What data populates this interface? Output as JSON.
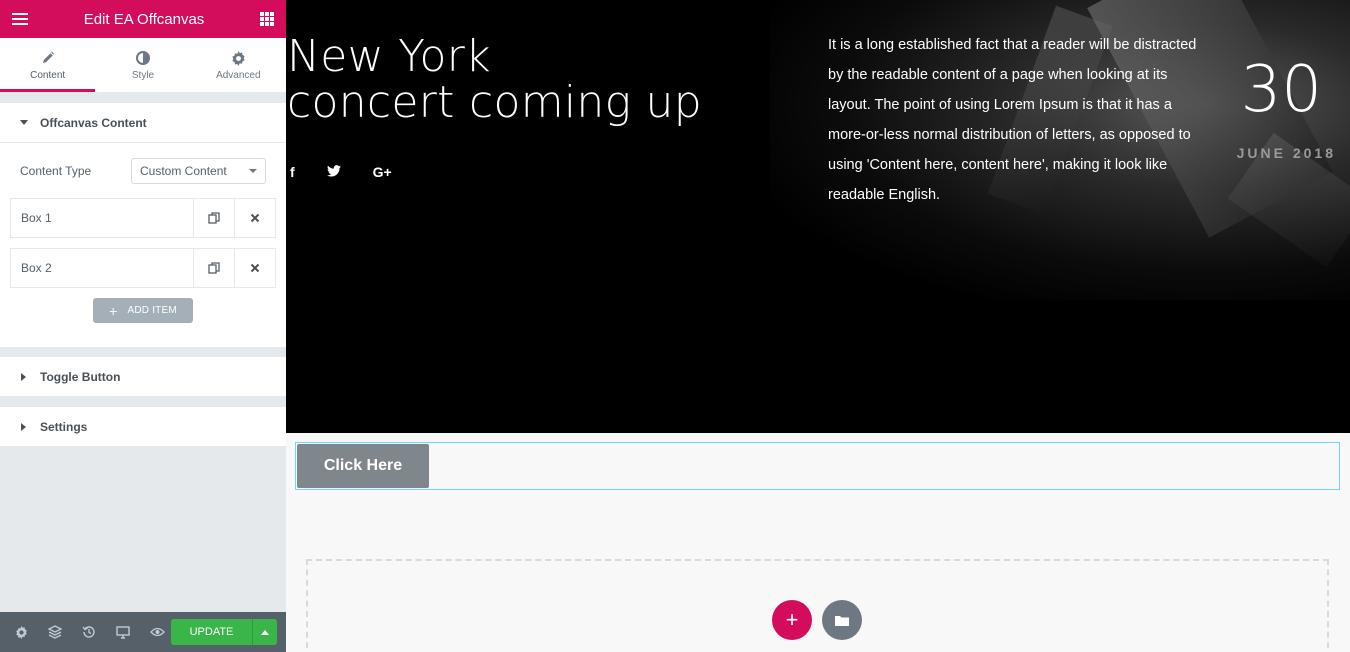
{
  "panel": {
    "title": "Edit EA Offcanvas",
    "tabs": [
      {
        "label": "Content",
        "icon": "pencil-icon"
      },
      {
        "label": "Style",
        "icon": "contrast-icon"
      },
      {
        "label": "Advanced",
        "icon": "gear-icon"
      }
    ],
    "sections": {
      "offcanvas_content": "Offcanvas Content",
      "toggle_button": "Toggle Button",
      "settings": "Settings"
    },
    "content_type": {
      "label": "Content Type",
      "value": "Custom Content"
    },
    "items": [
      {
        "title": "Box 1"
      },
      {
        "title": "Box 2"
      }
    ],
    "add_item_label": "ADD ITEM",
    "footer": {
      "update_label": "UPDATE"
    },
    "colors": {
      "accent": "#d30c5c",
      "update": "#39b54a",
      "footer": "#556068"
    }
  },
  "preview": {
    "hero": {
      "title_line1": "New York",
      "title_line2": "concert coming up",
      "social": [
        "f",
        "t",
        "G+"
      ],
      "text": "It is a long established fact that a reader will be distracted by the readable content of a page when looking at its layout. The point of using Lorem Ipsum is that it has a more-or-less normal distribution of letters, as opposed to using 'Content here, content here', making it look like readable English.",
      "day": "30",
      "month": "JUNE 2018"
    },
    "button_label": "Click Here"
  }
}
